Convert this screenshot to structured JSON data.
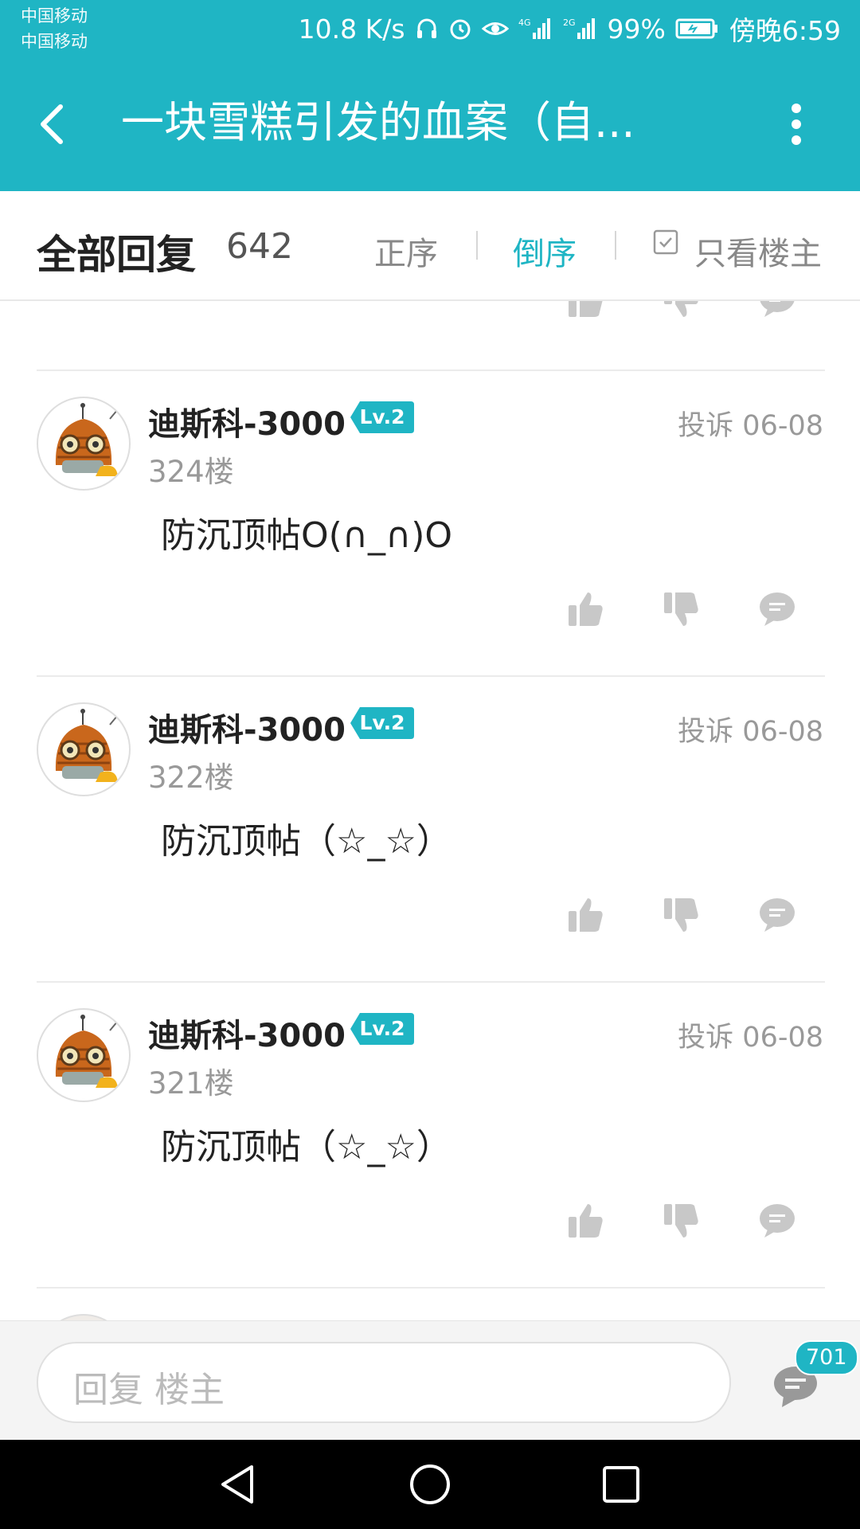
{
  "status_bar": {
    "carrier_1": "中国移动",
    "carrier_2": "中国移动",
    "net_speed": "10.8 K/s",
    "battery": "99%",
    "time": "傍晚6:59",
    "signal_1_label": "4G",
    "signal_2_label": "2G"
  },
  "app_bar": {
    "title": "一块雪糕引发的血案（自..."
  },
  "sort_bar": {
    "title": "全部回复",
    "count": "642",
    "ascending": "正序",
    "descending": "倒序",
    "only_op": "只看楼主",
    "active": "descending"
  },
  "posts": [
    {
      "user": "迪斯科-3000",
      "level": "Lv.2",
      "report": "投诉",
      "date": "06-08",
      "floor": "324楼",
      "text": "防沉顶帖O(∩_∩)O"
    },
    {
      "user": "迪斯科-3000",
      "level": "Lv.2",
      "report": "投诉",
      "date": "06-08",
      "floor": "322楼",
      "text": "防沉顶帖（☆_☆）"
    },
    {
      "user": "迪斯科-3000",
      "level": "Lv.2",
      "report": "投诉",
      "date": "06-08",
      "floor": "321楼",
      "text": "防沉顶帖（☆_☆）"
    }
  ],
  "footer": {
    "reply_placeholder": "回复  楼主",
    "comment_count": "701"
  },
  "colors": {
    "accent": "#1fb5c4",
    "icon_gray": "#c8c8c8",
    "text_dark": "#222222",
    "text_gray": "#999999"
  }
}
